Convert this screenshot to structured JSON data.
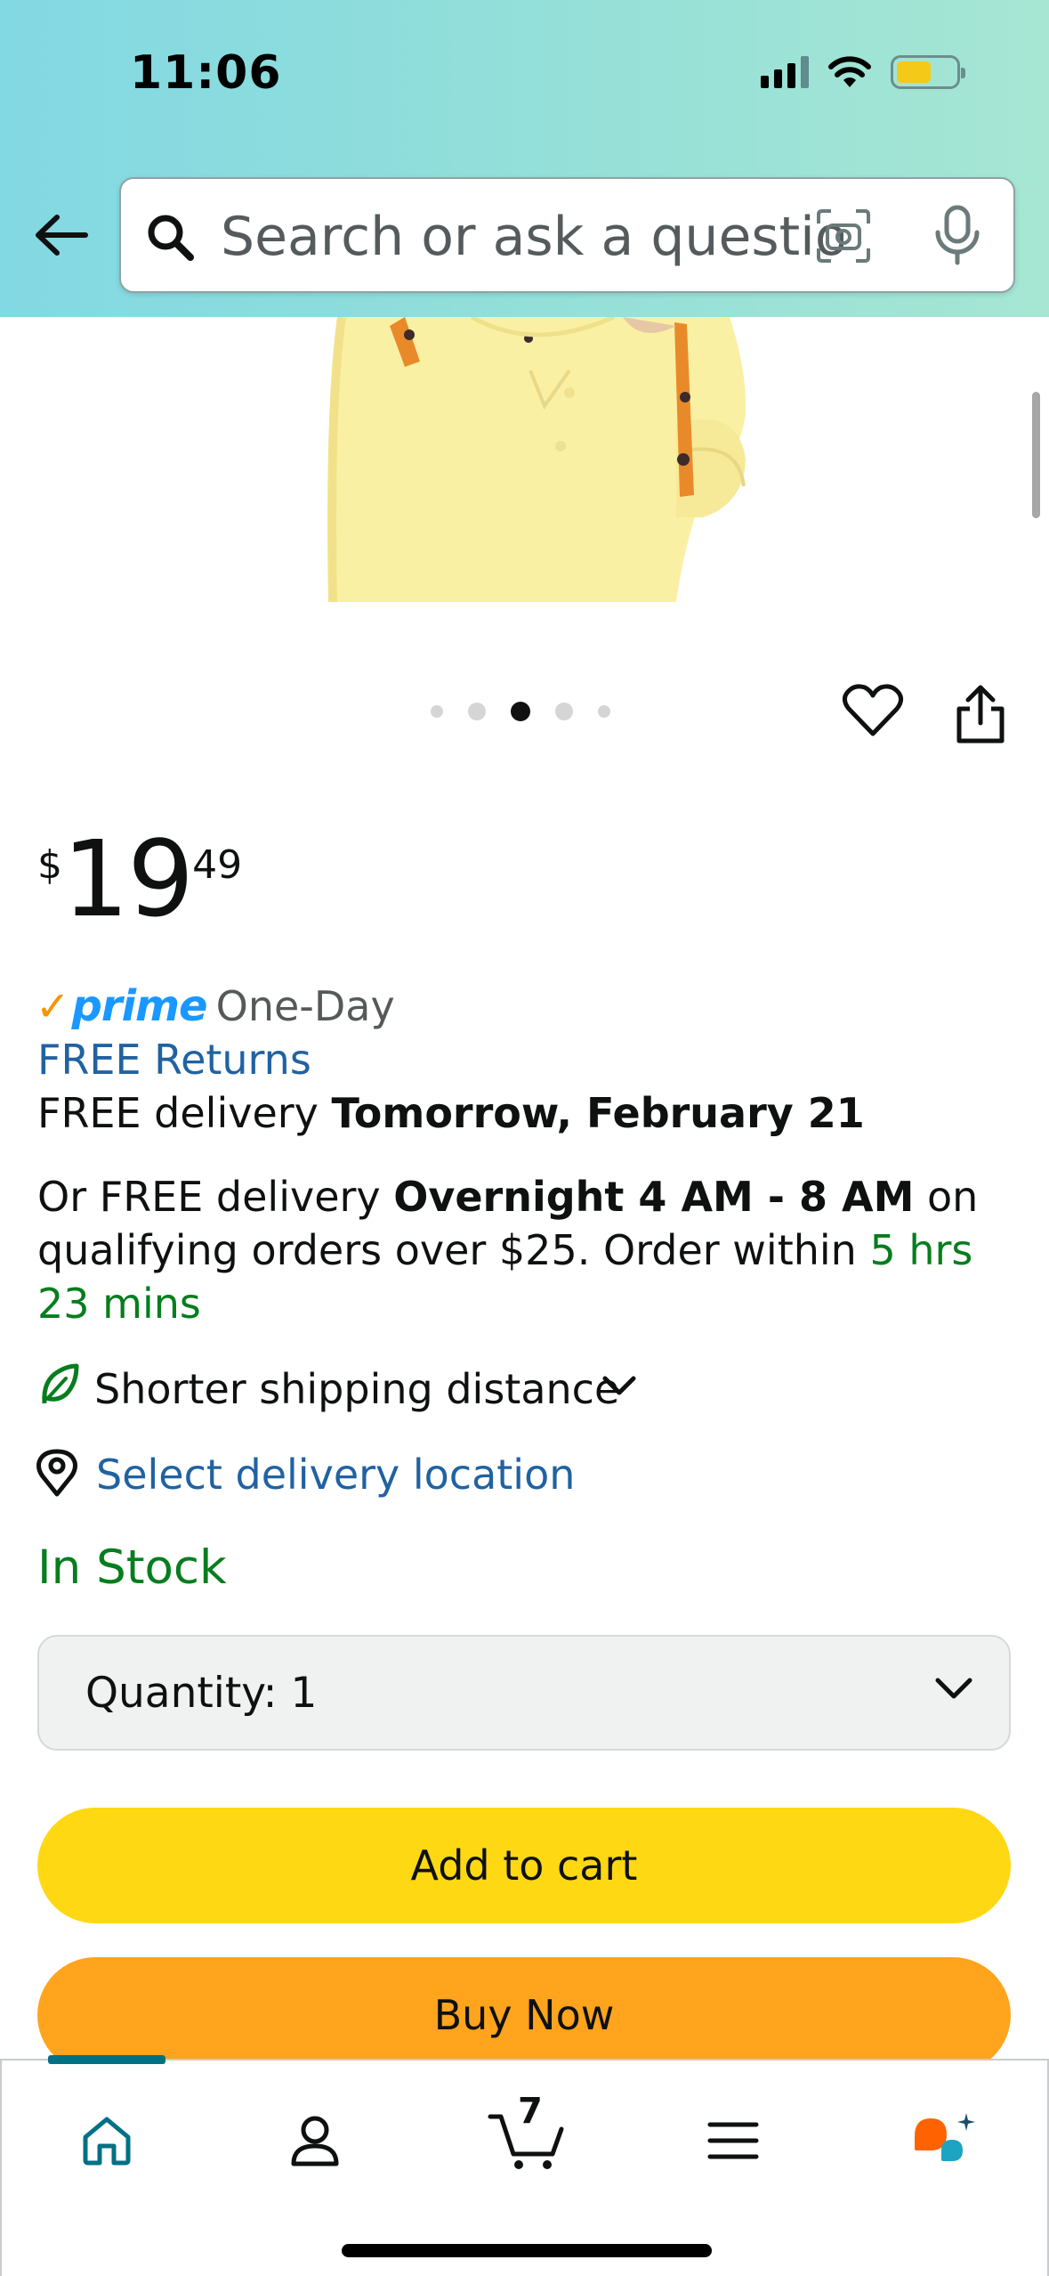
{
  "status_bar": {
    "time": "11:06"
  },
  "search": {
    "placeholder": "Search or ask a question"
  },
  "gallery": {
    "image_count": 5,
    "active_index": 2
  },
  "price": {
    "currency_symbol": "$",
    "whole": "19",
    "fraction": "49"
  },
  "delivery": {
    "prime_word": "prime",
    "prime_label": "One-Day",
    "free_returns": "FREE Returns",
    "free_delivery_prefix": "FREE delivery ",
    "free_delivery_date": "Tomorrow, February 21",
    "alt_prefix": "Or FREE delivery ",
    "alt_window": "Overnight 4 AM - 8 AM",
    "alt_middle": " on qualifying orders over $25. Order within ",
    "alt_countdown": "5 hrs 23 mins",
    "shipping_distance": "Shorter shipping distance",
    "select_location": "Select delivery location"
  },
  "availability": {
    "stock_status": "In Stock"
  },
  "quantity": {
    "label": "Quantity:",
    "value": "1"
  },
  "actions": {
    "add_to_cart": "Add to cart",
    "buy_now": "Buy Now"
  },
  "bottom_nav": {
    "cart_count": "7",
    "items": [
      "home-icon",
      "account-icon",
      "cart-icon",
      "menu-icon",
      "rufus-icon"
    ]
  },
  "colors": {
    "accent_teal": "#007185",
    "link_blue": "#2162a1",
    "stock_green": "#067d1e",
    "add_to_cart": "#ffd814",
    "buy_now": "#ffa41c",
    "prime_blue": "#1a98ff"
  }
}
